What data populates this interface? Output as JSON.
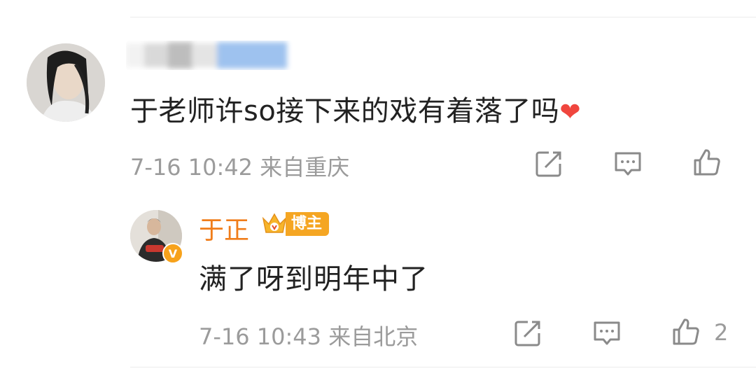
{
  "comment": {
    "text": "于老师许so接下来的戏有着落了吗",
    "emoji": "❤",
    "timestamp": "7-16 10:42",
    "location": "来自重庆"
  },
  "reply": {
    "author": "于正",
    "badge": "博主",
    "verified_mark": "V",
    "text": "满了呀到明年中了",
    "timestamp": "7-16 10:43",
    "location": "来自北京",
    "like_count": "2"
  },
  "colors": {
    "accent_orange": "#f07d1a",
    "badge_orange": "#f5a623",
    "heart_red": "#f0463e",
    "meta_gray": "#9b9b9b"
  },
  "icons": [
    "share-icon",
    "comment-icon",
    "like-icon",
    "verified-icon",
    "crown-icon"
  ]
}
